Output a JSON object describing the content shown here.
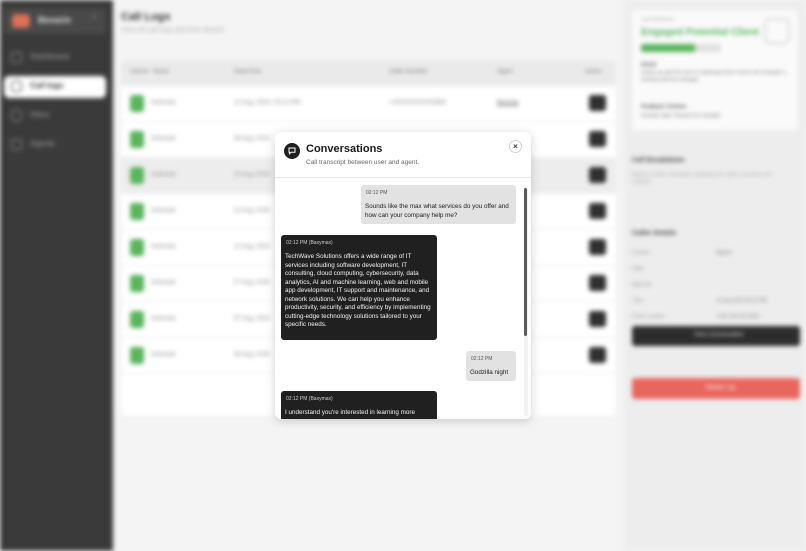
{
  "sidebar": {
    "brand": "Bevarin",
    "items": [
      {
        "label": "Dashboard"
      },
      {
        "label": "Call logs"
      },
      {
        "label": "Inbox"
      },
      {
        "label": "Agents"
      }
    ]
  },
  "main": {
    "title": "Call Logs",
    "subtitle": "View all call logs and their details",
    "columns": [
      "Call ter",
      "Name",
      "Date/Time",
      "Caller Number",
      "Agent",
      "Action"
    ],
    "rows": [
      {
        "name": "Unknown",
        "date": "12 Aug, 2024 / 02:12 PM",
        "number": "+XXXXXXXXXX5964",
        "agent": "Baxmax"
      },
      {
        "name": "Unknown",
        "date": "09 Aug, 2024"
      },
      {
        "name": "Unknown",
        "date": "10 Aug, 2024"
      },
      {
        "name": "Unknown",
        "date": "12 Aug, 2024"
      },
      {
        "name": "Unknown",
        "date": "12 Aug, 2024"
      },
      {
        "name": "Unknown",
        "date": "07 Aug, 2024"
      },
      {
        "name": "Unknown",
        "date": "07 Aug, 2024"
      },
      {
        "name": "Unknown",
        "date": "06 Aug, 2024"
      }
    ]
  },
  "panel": {
    "card_label": "Call Sentiment",
    "card_title": "Engaged Potential Client",
    "progress_value": 0.67,
    "progress_label": "67%",
    "action_label": "Action",
    "action_text": "Follow up with the user to understand their needs and schedule a meeting with the manager.",
    "feedback_label": "Feedback / Actions",
    "feedback_text": "Godzilla night, Request for manager",
    "breakdown_title": "Call Breakdown",
    "breakdown_sub": "Below is further information regarding the caller's emotions and analysis.",
    "details_title": "Caller Details",
    "details": [
      {
        "k": "Country",
        "v": "Nigeria"
      },
      {
        "k": "State",
        "v": ""
      },
      {
        "k": "Appcode",
        "v": ""
      },
      {
        "k": "Time",
        "v": "12 Aug 2024 02:12 PM"
      },
      {
        "k": "Phone number",
        "v": "+234 766 478 4654"
      }
    ],
    "view_btn": "View Conversation",
    "delete_btn": "Delete Log"
  },
  "modal": {
    "title": "Conversations",
    "subtitle": "Call transcript between user and agent.",
    "close": "×",
    "messages": [
      {
        "role": "user",
        "time": "02:12 PM",
        "text": "Sounds like the max what services do you offer and how can your company help me?"
      },
      {
        "role": "bot",
        "time": "02:12 PM (Baxymax)",
        "text": "TechWave Solutions offers a wide range of IT services including software development, IT consulting, cloud computing, cybersecurity, data analytics, AI and machine learning, web and mobile app development, IT support and maintenance, and network solutions. We can help you enhance productivity, security, and efficiency by implementing cutting-edge technology solutions tailored to your specific needs."
      },
      {
        "role": "user",
        "time": "02:12 PM",
        "text": "Godzilla night"
      },
      {
        "role": "bot",
        "time": "02:12 PM (Baxymax)",
        "text": "I understand you're interested in learning more"
      }
    ]
  }
}
